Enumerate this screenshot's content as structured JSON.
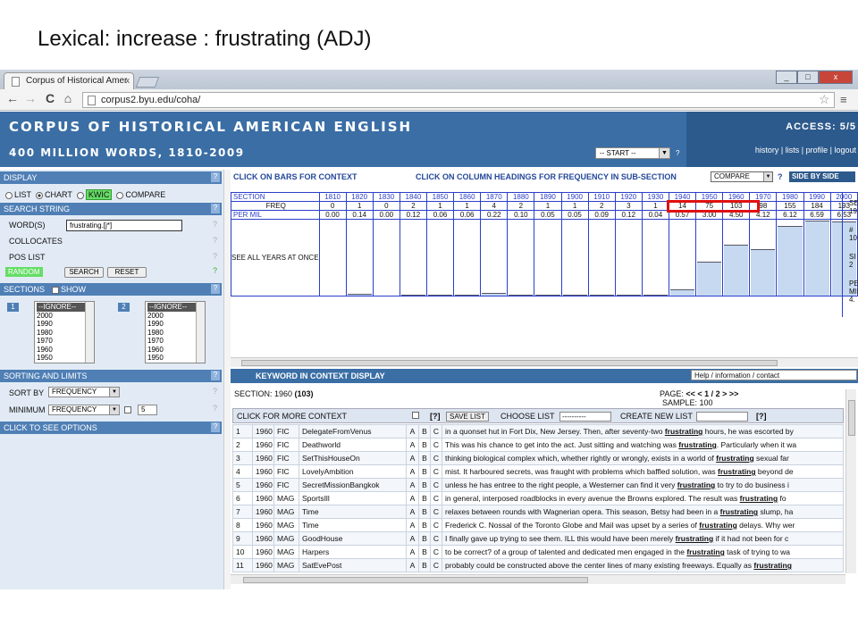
{
  "slide": {
    "title": "Lexical: increase : frustrating (ADJ)"
  },
  "browser": {
    "tab_title": "Corpus of Historical Amer",
    "url": "corpus2.byu.edu/coha/",
    "tab_close": "x",
    "win_min": "_",
    "win_max": "□",
    "win_close": "x",
    "back": "←",
    "forward": "→",
    "reload": "C",
    "home": "⌂",
    "star": "☆",
    "menu": "≡"
  },
  "header": {
    "title": "CORPUS OF HISTORICAL AMERICAN ENGLISH",
    "subtitle": "400 MILLION WORDS, 1810-2009",
    "access": "ACCESS: 5/5",
    "links": [
      "history",
      "lists",
      "profile",
      "logout"
    ],
    "start_select": "-- START --",
    "help_mark": "?"
  },
  "left": {
    "display_label": "DISPLAY",
    "display_options": [
      "LIST",
      "CHART",
      "KWIC",
      "COMPARE"
    ],
    "search_string_label": "SEARCH STRING",
    "words_label": "WORD(S)",
    "words_value": "frustrating.[j*]",
    "collocates_label": "COLLOCATES",
    "pos_list_label": "POS LIST",
    "random_label": "RANDOM",
    "search_button": "SEARCH",
    "reset_button": "RESET",
    "sections_label": "SECTIONS",
    "show_label": "SHOW",
    "list1_num": "1",
    "list2_num": "2",
    "list_items": [
      "--IGNORE--",
      "2000",
      "1990",
      "1980",
      "1970",
      "1960",
      "1950"
    ],
    "sorting_label": "SORTING AND LIMITS",
    "sort_by_label": "SORT BY",
    "sort_by_value": "FREQUENCY",
    "minimum_label": "MINIMUM",
    "minimum_value": "FREQUENCY",
    "minimum_number": "5",
    "options_label": "CLICK TO SEE OPTIONS",
    "hq": "?"
  },
  "chart": {
    "bar_text": "CLICK ON BARS FOR CONTEXT",
    "col_text": "CLICK ON COLUMN HEADINGS FOR FREQUENCY IN SUB-SECTION",
    "compare": "COMPARE",
    "q": "?",
    "side_by_side": "SIDE BY SIDE",
    "row_labels": [
      "SECTION",
      "FREQ",
      "PER MIL"
    ],
    "see_all": "SEE ALL YEARS AT ONCE",
    "side_labels": [
      "SE",
      "19",
      "#",
      "10",
      "SI",
      "2",
      "PE",
      "MIL",
      "4."
    ]
  },
  "chart_data": {
    "type": "bar",
    "categories": [
      "1810",
      "1820",
      "1830",
      "1840",
      "1850",
      "1860",
      "1870",
      "1880",
      "1890",
      "1900",
      "1910",
      "1920",
      "1930",
      "1940",
      "1950",
      "1960",
      "1970",
      "1980",
      "1990",
      "2000"
    ],
    "freq": [
      0,
      1,
      0,
      2,
      1,
      1,
      4,
      2,
      1,
      1,
      2,
      3,
      1,
      14,
      75,
      103,
      98,
      155,
      184,
      193
    ],
    "per_mil_labels": [
      "0.00",
      "0.14",
      "0.00",
      "0.12",
      "0.06",
      "0.06",
      "0.22",
      "0.10",
      "0.05",
      "0.05",
      "0.09",
      "0.12",
      "0.04",
      "0.57",
      "3.00",
      "4.50",
      "4.12",
      "6.12",
      "6.59",
      "6.53"
    ],
    "values": [
      0.0,
      0.14,
      0.0,
      0.12,
      0.06,
      0.06,
      0.22,
      0.1,
      0.05,
      0.05,
      0.09,
      0.12,
      0.04,
      0.57,
      3.0,
      4.5,
      4.12,
      6.12,
      6.59,
      6.53
    ],
    "ylim": [
      0,
      6.6
    ],
    "highlight": [
      "1950",
      "1960",
      "1970"
    ]
  },
  "kwic": {
    "bar_title": "KEYWORD IN CONTEXT DISPLAY",
    "help": "Help / information / contact",
    "section_label": "SECTION: 1960",
    "section_count": "(103)",
    "page_label": "PAGE:",
    "page_nav": "<<  <  1 / 2  >  >>",
    "sample": "SAMPLE: 100",
    "click_more": "CLICK FOR MORE CONTEXT",
    "help_q": "[?]",
    "save_list": "SAVE LIST",
    "choose_list": "CHOOSE LIST",
    "choose_value": "----------",
    "create_list": "CREATE NEW LIST",
    "rows": [
      {
        "n": "1",
        "year": "1960",
        "genre": "FIC",
        "source": "DelegateFromVenus",
        "pre": "in a quonset hut in Fort Dix, New Jersey. Then, after seventy-two ",
        "kw": "frustrating",
        "post": " hours, he was escorted by"
      },
      {
        "n": "2",
        "year": "1960",
        "genre": "FIC",
        "source": "Deathworld",
        "pre": "This was his chance to get into the act. Just sitting and watching was ",
        "kw": "frustrating",
        "post": ". Particularly when it wa"
      },
      {
        "n": "3",
        "year": "1960",
        "genre": "FIC",
        "source": "SetThisHouseOn",
        "pre": "thinking biological complex which, whether rightly or wrongly, exists in a world of ",
        "kw": "frustrating",
        "post": " sexual far"
      },
      {
        "n": "4",
        "year": "1960",
        "genre": "FIC",
        "source": "LovelyAmbition",
        "pre": "mist. It harboured secrets, was fraught with problems which baffled solution, was ",
        "kw": "frustrating",
        "post": " beyond de"
      },
      {
        "n": "5",
        "year": "1960",
        "genre": "FIC",
        "source": "SecretMissionBangkok",
        "pre": "unless he has entree to the right people, a Westerner can find it very ",
        "kw": "frustrating",
        "post": " to try to do business i"
      },
      {
        "n": "6",
        "year": "1960",
        "genre": "MAG",
        "source": "SportsIll",
        "pre": "in general, interposed roadblocks in every avenue the Browns explored. The result was ",
        "kw": "frustrating",
        "post": " fo"
      },
      {
        "n": "7",
        "year": "1960",
        "genre": "MAG",
        "source": "Time",
        "pre": "relaxes between rounds with Wagnerian opera. This season, Betsy had been in a ",
        "kw": "frustrating",
        "post": " slump, ha"
      },
      {
        "n": "8",
        "year": "1960",
        "genre": "MAG",
        "source": "Time",
        "pre": "Frederick C. Nossal of the Toronto Globe and Mail was upset by a series of ",
        "kw": "frustrating",
        "post": " delays. Why wer"
      },
      {
        "n": "9",
        "year": "1960",
        "genre": "MAG",
        "source": "GoodHouse",
        "pre": "I finally gave up trying to see them. ILL this would have been merely ",
        "kw": "frustrating",
        "post": " if it had not been for c"
      },
      {
        "n": "10",
        "year": "1960",
        "genre": "MAG",
        "source": "Harpers",
        "pre": "to be correct? of a group of talented and dedicated men engaged in the ",
        "kw": "frustrating",
        "post": " task of trying to wa"
      },
      {
        "n": "11",
        "year": "1960",
        "genre": "MAG",
        "source": "SatEvePost",
        "pre": "probably could be constructed above the center lines of many existing freeways. Equally as ",
        "kw": "frustrating",
        "post": ""
      }
    ]
  }
}
